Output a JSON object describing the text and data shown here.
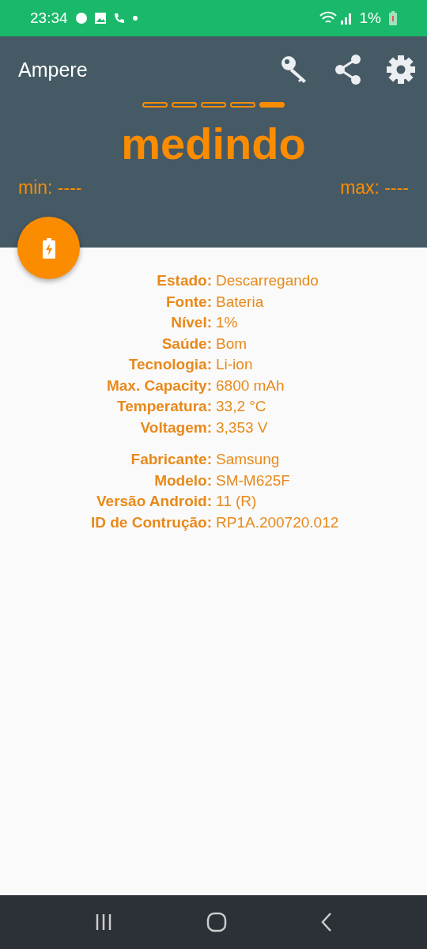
{
  "status_bar": {
    "time": "23:34",
    "battery": "1%"
  },
  "app_bar": {
    "title": "Ampere"
  },
  "indicator": [
    {
      "filled": false
    },
    {
      "filled": false
    },
    {
      "filled": false
    },
    {
      "filled": false
    },
    {
      "filled": true
    }
  ],
  "reading": "medindo",
  "min": "min: ----",
  "max": "max: ----",
  "groups": [
    {
      "rows": [
        {
          "label": "Estado:",
          "value": "Descarregando"
        },
        {
          "label": "Fonte:",
          "value": "Bateria"
        },
        {
          "label": "Nível:",
          "value": "1%"
        },
        {
          "label": "Saúde:",
          "value": "Bom"
        },
        {
          "label": "Tecnologia:",
          "value": "Li-ion"
        },
        {
          "label": "Max. Capacity:",
          "value": "6800 mAh"
        },
        {
          "label": "Temperatura:",
          "value": "33,2 °C"
        },
        {
          "label": "Voltagem:",
          "value": "3,353 V"
        }
      ]
    },
    {
      "rows": [
        {
          "label": "Fabricante:",
          "value": "Samsung"
        },
        {
          "label": "Modelo:",
          "value": "SM-M625F"
        },
        {
          "label": "Versão Android:",
          "value": "11 (R)"
        },
        {
          "label": "ID de Contrução:",
          "value": "RP1A.200720.012"
        }
      ]
    }
  ]
}
